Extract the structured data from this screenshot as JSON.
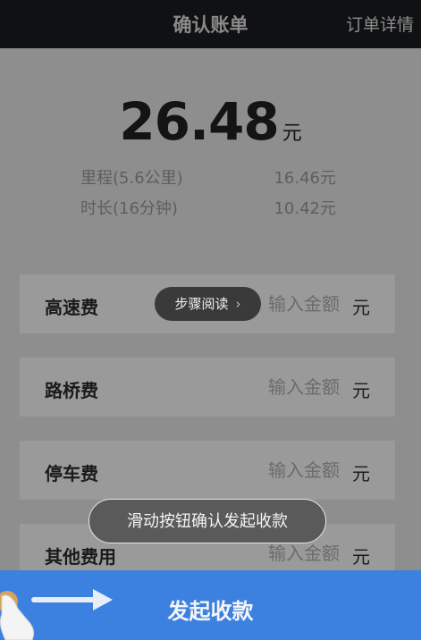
{
  "header": {
    "title": "确认账单",
    "right_link": "订单详情"
  },
  "amount": {
    "value": "26.48",
    "unit": "元"
  },
  "details": [
    {
      "label": "里程(5.6公里)",
      "value": "16.46元"
    },
    {
      "label": "时长(16分钟)",
      "value": "10.42元"
    }
  ],
  "fees": [
    {
      "label": "高速费",
      "placeholder": "输入金额",
      "unit": "元"
    },
    {
      "label": "路桥费",
      "placeholder": "输入金额",
      "unit": "元"
    },
    {
      "label": "停车费",
      "placeholder": "输入金额",
      "unit": "元"
    },
    {
      "label": "其他费用",
      "placeholder": "输入金额",
      "unit": "元"
    }
  ],
  "overlay": {
    "steps_label": "步骤阅读",
    "steps_chevron": "›",
    "toast": "滑动按钮确认发起收款"
  },
  "bottom": {
    "label": "发起收款"
  },
  "colors": {
    "accent": "#3d81e0",
    "topbar": "#101113"
  }
}
